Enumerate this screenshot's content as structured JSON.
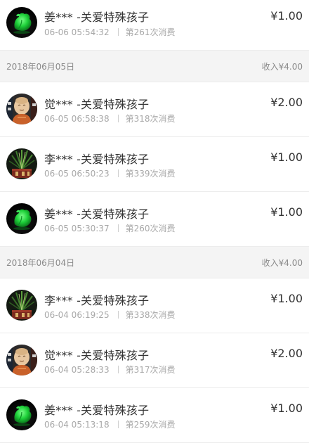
{
  "colors": {
    "divider": "#ececec",
    "header_bg": "#f4f4f4",
    "muted_text": "#a8a8a8"
  },
  "groups": [
    {
      "header": null,
      "rows": [
        {
          "avatar": "green-leaf-avatar-icon",
          "name": "姜*** -关爱特殊孩子",
          "time": "06-06 05:54:32",
          "count": "第261次消费",
          "amount": "¥1.00"
        }
      ]
    },
    {
      "header": {
        "date": "2018年06月05日",
        "income": "收入¥4.00"
      },
      "rows": [
        {
          "avatar": "buddha-statue-avatar-icon",
          "name": "觉*** -关爱特殊孩子",
          "time": "06-05 06:58:38",
          "count": "第318次消费",
          "amount": "¥2.00"
        },
        {
          "avatar": "potted-plant-avatar-icon",
          "name": "李*** -关爱特殊孩子",
          "time": "06-05 06:50:23",
          "count": "第339次消费",
          "amount": "¥1.00"
        },
        {
          "avatar": "green-leaf-avatar-icon",
          "name": "姜*** -关爱特殊孩子",
          "time": "06-05 05:30:37",
          "count": "第260次消费",
          "amount": "¥1.00"
        }
      ]
    },
    {
      "header": {
        "date": "2018年06月04日",
        "income": "收入¥4.00"
      },
      "rows": [
        {
          "avatar": "potted-plant-avatar-icon",
          "name": "李*** -关爱特殊孩子",
          "time": "06-04 06:19:25",
          "count": "第338次消费",
          "amount": "¥1.00"
        },
        {
          "avatar": "buddha-statue-avatar-icon",
          "name": "觉*** -关爱特殊孩子",
          "time": "06-04 05:28:33",
          "count": "第317次消费",
          "amount": "¥2.00"
        },
        {
          "avatar": "green-leaf-avatar-icon",
          "name": "姜*** -关爱特殊孩子",
          "time": "06-04 05:13:18",
          "count": "第259次消费",
          "amount": "¥1.00"
        }
      ]
    }
  ]
}
